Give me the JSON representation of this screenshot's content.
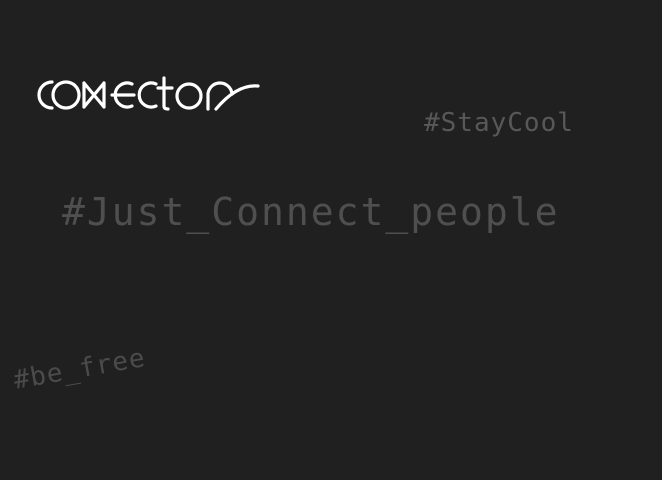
{
  "logo": {
    "wordmark": "connector"
  },
  "tags": {
    "stay_cool": "#StayCool",
    "just_connect": "#Just_Connect_people",
    "be_free": "#be_free"
  },
  "colors": {
    "background": "#202020",
    "logo": "#ffffff",
    "tag_text": "#555555"
  }
}
